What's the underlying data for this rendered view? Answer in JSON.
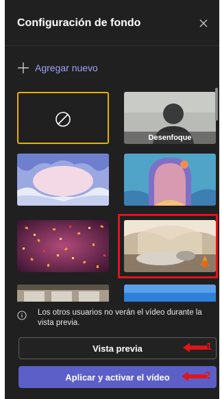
{
  "header": {
    "title": "Configuración de fondo"
  },
  "add_new": {
    "label": "Agregar nuevo"
  },
  "backgrounds": [
    {
      "id": "none",
      "label": ""
    },
    {
      "id": "blur",
      "label": "Desenfoque"
    },
    {
      "id": "ice-cave",
      "label": ""
    },
    {
      "id": "arch-balloon",
      "label": ""
    },
    {
      "id": "confetti",
      "label": ""
    },
    {
      "id": "fort-room",
      "label": ""
    },
    {
      "id": "loft",
      "label": ""
    },
    {
      "id": "blue-room",
      "label": ""
    }
  ],
  "info": {
    "text": "Los otros usuarios no verán el vídeo durante la vista previa."
  },
  "buttons": {
    "preview": "Vista previa",
    "apply": "Aplicar y activar el vídeo"
  },
  "annotations": {
    "arrow1": "1",
    "arrow2": "2"
  },
  "colors": {
    "accent": "#5b5fc7",
    "selected_border": "#e7b300",
    "annotation_red": "#e0141c"
  }
}
